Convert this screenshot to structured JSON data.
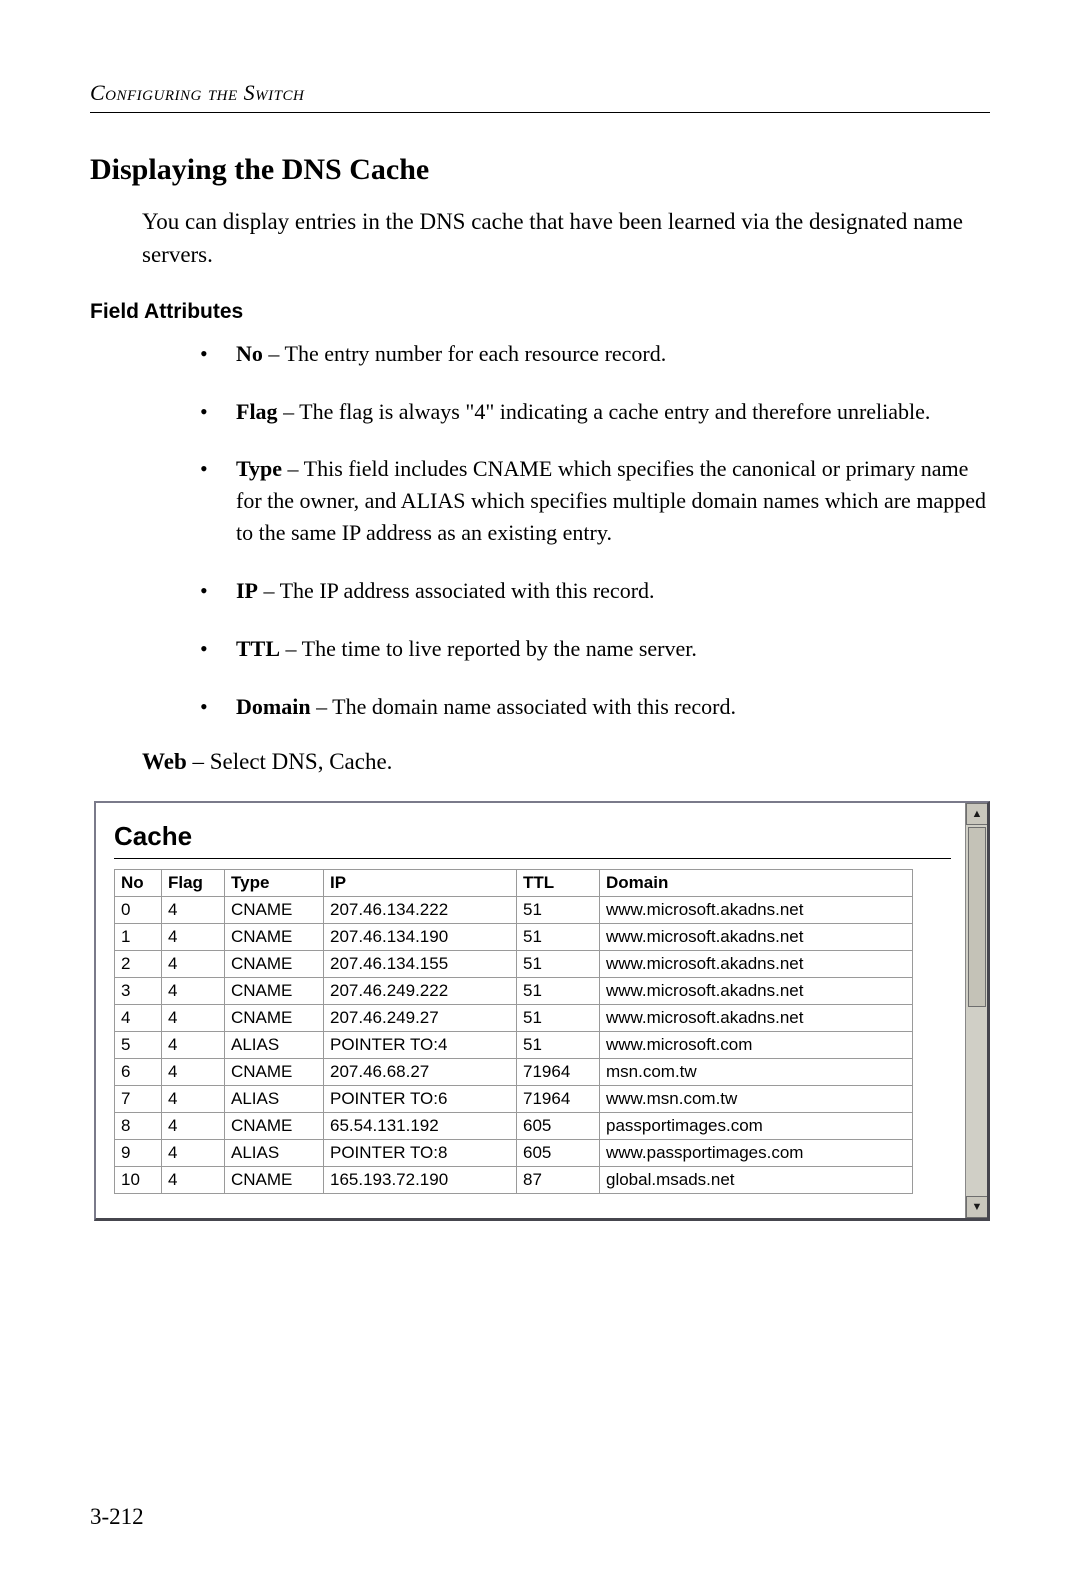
{
  "running_head": "Configuring the Switch",
  "section_title": "Displaying the DNS Cache",
  "intro": "You can display entries in the DNS cache that have been learned via the designated name servers.",
  "field_attributes_label": "Field Attributes",
  "attributes": [
    {
      "name": "No",
      "sep": " – ",
      "desc": "The entry number for each resource record."
    },
    {
      "name": "Flag",
      "sep": " – ",
      "desc": "The flag is always \"4\" indicating a cache entry and therefore unreliable."
    },
    {
      "name": "Type",
      "sep": " – ",
      "desc": "This field includes CNAME which specifies the canonical or primary name for the owner, and ALIAS which specifies multiple domain names which are mapped to the same IP address as an existing entry."
    },
    {
      "name": "IP",
      "sep": " – ",
      "desc": "The IP address associated with this record."
    },
    {
      "name": "TTL",
      "sep": " – ",
      "desc": "The time to live reported by the name server."
    },
    {
      "name": "Domain",
      "sep": " – ",
      "desc": "The domain name associated with this record."
    }
  ],
  "web_note": {
    "prefix": "Web",
    "sep": " – ",
    "rest": "Select DNS, Cache."
  },
  "cache": {
    "title": "Cache",
    "columns": [
      "No",
      "Flag",
      "Type",
      "IP",
      "TTL",
      "Domain"
    ],
    "rows": [
      {
        "no": "0",
        "flag": "4",
        "type": "CNAME",
        "ip": "207.46.134.222",
        "ttl": "51",
        "domain": "www.microsoft.akadns.net"
      },
      {
        "no": "1",
        "flag": "4",
        "type": "CNAME",
        "ip": "207.46.134.190",
        "ttl": "51",
        "domain": "www.microsoft.akadns.net"
      },
      {
        "no": "2",
        "flag": "4",
        "type": "CNAME",
        "ip": "207.46.134.155",
        "ttl": "51",
        "domain": "www.microsoft.akadns.net"
      },
      {
        "no": "3",
        "flag": "4",
        "type": "CNAME",
        "ip": "207.46.249.222",
        "ttl": "51",
        "domain": "www.microsoft.akadns.net"
      },
      {
        "no": "4",
        "flag": "4",
        "type": "CNAME",
        "ip": "207.46.249.27",
        "ttl": "51",
        "domain": "www.microsoft.akadns.net"
      },
      {
        "no": "5",
        "flag": "4",
        "type": "ALIAS",
        "ip": "POINTER TO:4",
        "ttl": "51",
        "domain": "www.microsoft.com"
      },
      {
        "no": "6",
        "flag": "4",
        "type": "CNAME",
        "ip": "207.46.68.27",
        "ttl": "71964",
        "domain": "msn.com.tw"
      },
      {
        "no": "7",
        "flag": "4",
        "type": "ALIAS",
        "ip": "POINTER TO:6",
        "ttl": "71964",
        "domain": "www.msn.com.tw"
      },
      {
        "no": "8",
        "flag": "4",
        "type": "CNAME",
        "ip": "65.54.131.192",
        "ttl": "605",
        "domain": "passportimages.com"
      },
      {
        "no": "9",
        "flag": "4",
        "type": "ALIAS",
        "ip": "POINTER TO:8",
        "ttl": "605",
        "domain": "www.passportimages.com"
      },
      {
        "no": "10",
        "flag": "4",
        "type": "CNAME",
        "ip": "165.193.72.190",
        "ttl": "87",
        "domain": "global.msads.net"
      }
    ]
  },
  "page_number": "3-212",
  "scroll": {
    "up_glyph": "▲",
    "down_glyph": "▼"
  }
}
